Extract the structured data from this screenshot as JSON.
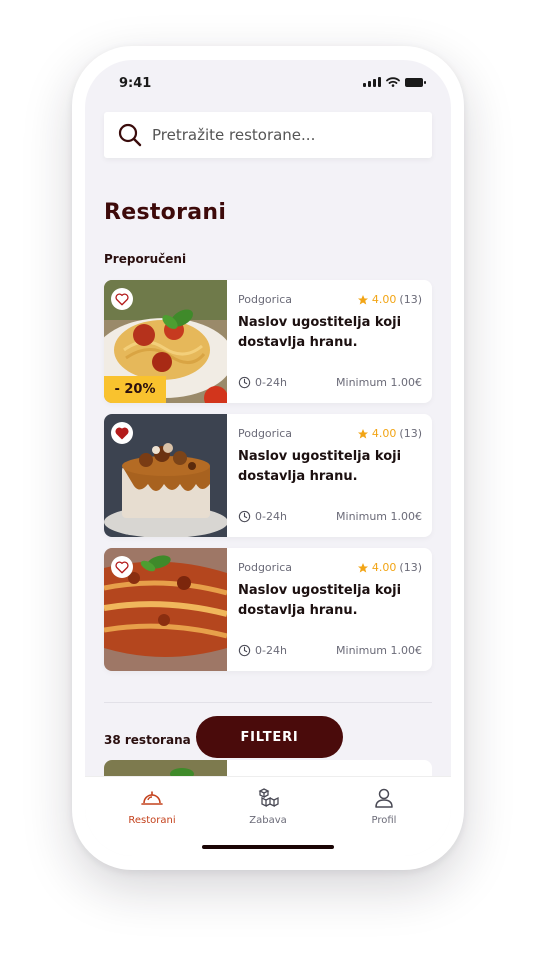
{
  "status": {
    "time": "9:41"
  },
  "search": {
    "placeholder": "Pretražite restorane..."
  },
  "page": {
    "title": "Restorani",
    "recommended_label": "Preporučeni"
  },
  "restaurants": [
    {
      "city": "Podgorica",
      "rating": "4.00",
      "reviews": "(13)",
      "name": "Naslov ugostitelja koji dostavlja hranu.",
      "hours": "0-24h",
      "minimum": "Minimum 1.00€",
      "discount": "- 20%",
      "favorite": false,
      "image": "spaghetti"
    },
    {
      "city": "Podgorica",
      "rating": "4.00",
      "reviews": "(13)",
      "name": "Naslov ugostitelja koji dostavlja hranu.",
      "hours": "0-24h",
      "minimum": "Minimum 1.00€",
      "favorite": true,
      "image": "cake"
    },
    {
      "city": "Podgorica",
      "rating": "4.00",
      "reviews": "(13)",
      "name": "Naslov ugostitelja koji dostavlja hranu.",
      "hours": "0-24h",
      "minimum": "Minimum 1.00€",
      "favorite": false,
      "image": "lasagna"
    }
  ],
  "list": {
    "count_label": "38 restorana",
    "filter_button": "FILTERI"
  },
  "nav": [
    {
      "label": "Restorani",
      "icon": "cloche-icon",
      "active": true
    },
    {
      "label": "Zabava",
      "icon": "boxes-icon",
      "active": false
    },
    {
      "label": "Profil",
      "icon": "user-icon",
      "active": false
    }
  ],
  "colors": {
    "brand": "#4a0b0b",
    "accent": "#c4421d",
    "star": "#f2a516",
    "badge": "#f9c22e",
    "background": "#f3f2f7"
  }
}
